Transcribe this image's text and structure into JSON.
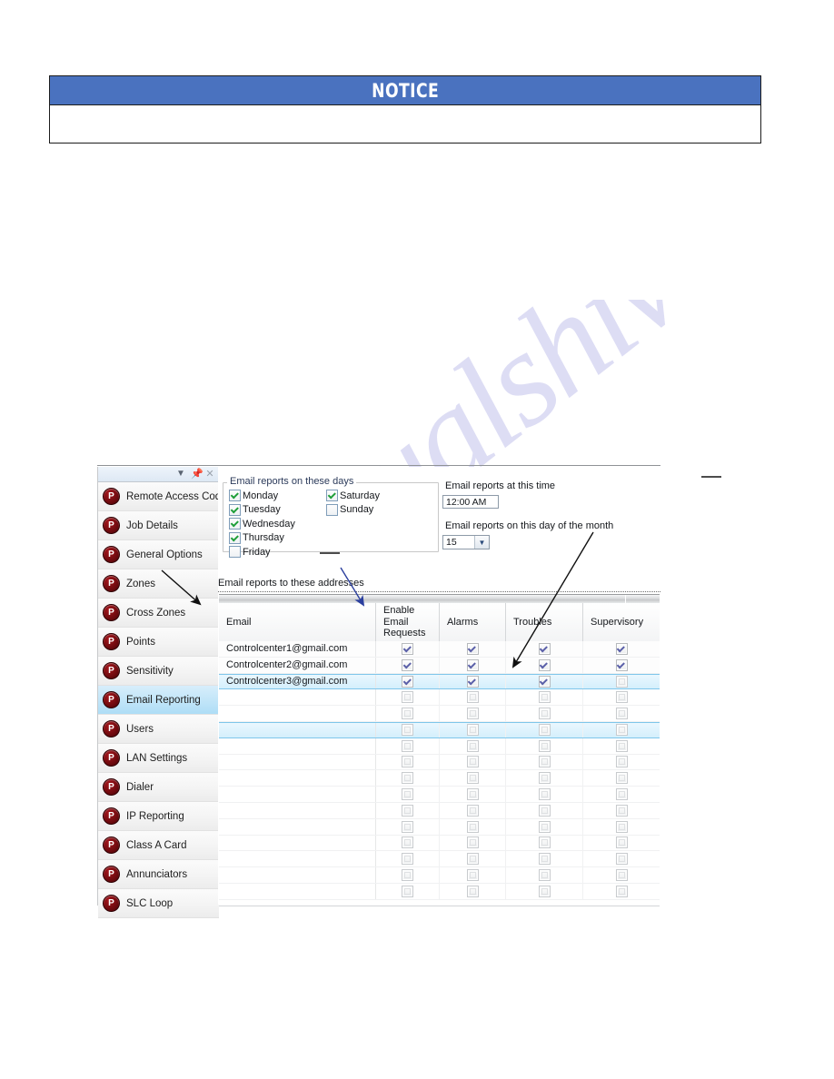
{
  "notice": {
    "title": "NOTICE",
    "body_text": ""
  },
  "watermark": {
    "text": "manualshive.com"
  },
  "panel": {
    "titlebar_icons": {
      "dropdown": "chevron-down-icon",
      "pin": "pin-icon",
      "close": "close-icon"
    }
  },
  "sidebar": {
    "items": [
      {
        "label": "Remote Access Code",
        "selected": false
      },
      {
        "label": "Job Details",
        "selected": false
      },
      {
        "label": "General Options",
        "selected": false
      },
      {
        "label": "Zones",
        "selected": false
      },
      {
        "label": "Cross Zones",
        "selected": false
      },
      {
        "label": "Points",
        "selected": false
      },
      {
        "label": "Sensitivity",
        "selected": false
      },
      {
        "label": "Email Reporting",
        "selected": true
      },
      {
        "label": "Users",
        "selected": false
      },
      {
        "label": "LAN Settings",
        "selected": false
      },
      {
        "label": "Dialer",
        "selected": false
      },
      {
        "label": "IP Reporting",
        "selected": false
      },
      {
        "label": "Class A Card",
        "selected": false
      },
      {
        "label": "Annunciators",
        "selected": false
      },
      {
        "label": "SLC Loop",
        "selected": false
      }
    ],
    "icon_name": "P"
  },
  "form": {
    "days_group_title": "Email reports on these days",
    "days_left": [
      {
        "label": "Monday",
        "checked": true
      },
      {
        "label": "Tuesday",
        "checked": true
      },
      {
        "label": "Wednesday",
        "checked": true
      },
      {
        "label": "Thursday",
        "checked": true
      },
      {
        "label": "Friday",
        "checked": false
      }
    ],
    "days_right": [
      {
        "label": "Saturday",
        "checked": true
      },
      {
        "label": "Sunday",
        "checked": false
      }
    ],
    "time_label": "Email reports at this time",
    "time_value": "12:00 AM",
    "day_of_month_label": "Email reports on this day of the month",
    "day_of_month_value": "15",
    "addresses_label": "Email reports to these addresses"
  },
  "grid": {
    "columns": [
      "Email",
      "Enable\nEmail\nRequests",
      "Alarms",
      "Troubles",
      "Supervisory"
    ],
    "column_labels": {
      "email": "Email",
      "enable_line1": "Enable",
      "enable_line2": "Email",
      "enable_line3": "Requests",
      "alarms": "Alarms",
      "troubles": "Troubles",
      "supervisory": "Supervisory"
    },
    "rows": [
      {
        "email": "Controlcenter1@gmail.com",
        "enable": true,
        "alarms": true,
        "troubles": true,
        "supervisory": true,
        "selected": false
      },
      {
        "email": "Controlcenter2@gmail.com",
        "enable": true,
        "alarms": true,
        "troubles": true,
        "supervisory": true,
        "selected": false
      },
      {
        "email": "Controlcenter3@gmail.com",
        "enable": true,
        "alarms": true,
        "troubles": true,
        "supervisory": false,
        "selected": true
      }
    ],
    "empty_row_count": 13,
    "selected_empty_row_index": 2
  },
  "colors": {
    "notice_banner": "#4a72bf",
    "selection": "#bfe4f8",
    "icon_red": "#7d0d12",
    "watermark": "#c9c9ee"
  }
}
